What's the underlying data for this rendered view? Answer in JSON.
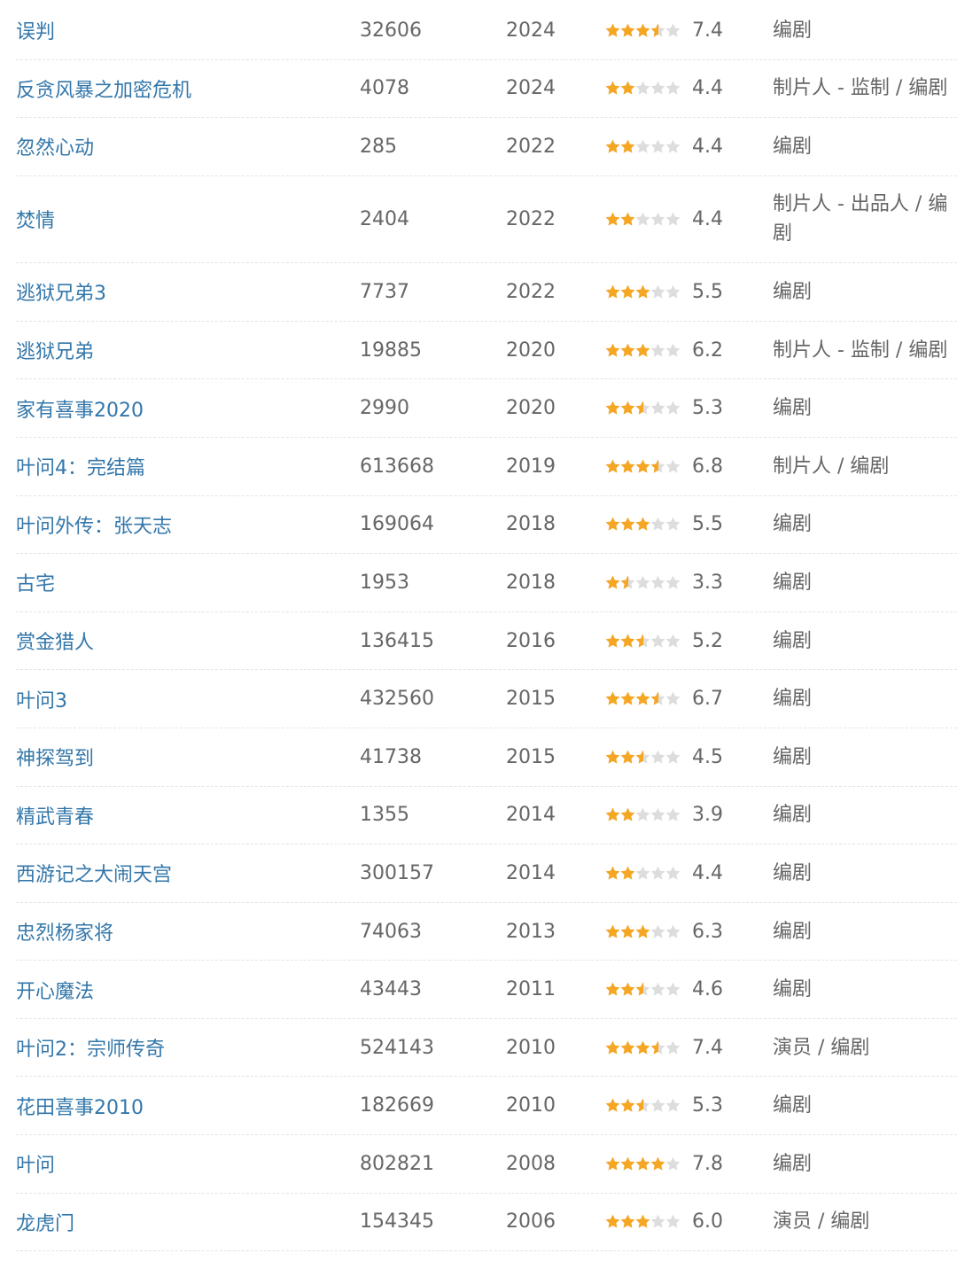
{
  "colors": {
    "link": "#3377aa",
    "text": "#666666",
    "star_filled": "#f5a623",
    "star_empty": "#dddddd"
  },
  "icon": "star-icon",
  "works": [
    {
      "title": "误判",
      "votes": "32606",
      "year": "2024",
      "stars": 3.5,
      "rating": "7.4",
      "role": "编剧"
    },
    {
      "title": "反贪风暴之加密危机",
      "votes": "4078",
      "year": "2024",
      "stars": 2,
      "rating": "4.4",
      "role": "制片人 - 监制 / 编剧"
    },
    {
      "title": "忽然心动",
      "votes": "285",
      "year": "2022",
      "stars": 2,
      "rating": "4.4",
      "role": "编剧"
    },
    {
      "title": "焚情",
      "votes": "2404",
      "year": "2022",
      "stars": 2,
      "rating": "4.4",
      "role": "制片人 - 出品人 / 编剧"
    },
    {
      "title": "逃狱兄弟3",
      "votes": "7737",
      "year": "2022",
      "stars": 3,
      "rating": "5.5",
      "role": "编剧"
    },
    {
      "title": "逃狱兄弟",
      "votes": "19885",
      "year": "2020",
      "stars": 3,
      "rating": "6.2",
      "role": "制片人 - 监制 / 编剧"
    },
    {
      "title": "家有喜事2020",
      "votes": "2990",
      "year": "2020",
      "stars": 2.5,
      "rating": "5.3",
      "role": "编剧"
    },
    {
      "title": "叶问4：完结篇",
      "votes": "613668",
      "year": "2019",
      "stars": 3.5,
      "rating": "6.8",
      "role": "制片人 / 编剧"
    },
    {
      "title": "叶问外传：张天志",
      "votes": "169064",
      "year": "2018",
      "stars": 3,
      "rating": "5.5",
      "role": "编剧"
    },
    {
      "title": "古宅",
      "votes": "1953",
      "year": "2018",
      "stars": 1.5,
      "rating": "3.3",
      "role": "编剧"
    },
    {
      "title": "赏金猎人",
      "votes": "136415",
      "year": "2016",
      "stars": 2.5,
      "rating": "5.2",
      "role": "编剧"
    },
    {
      "title": "叶问3",
      "votes": "432560",
      "year": "2015",
      "stars": 3.5,
      "rating": "6.7",
      "role": "编剧"
    },
    {
      "title": "神探驾到",
      "votes": "41738",
      "year": "2015",
      "stars": 2.5,
      "rating": "4.5",
      "role": "编剧"
    },
    {
      "title": "精武青春",
      "votes": "1355",
      "year": "2014",
      "stars": 2,
      "rating": "3.9",
      "role": "编剧"
    },
    {
      "title": "西游记之大闹天宫",
      "votes": "300157",
      "year": "2014",
      "stars": 2,
      "rating": "4.4",
      "role": "编剧"
    },
    {
      "title": "忠烈杨家将",
      "votes": "74063",
      "year": "2013",
      "stars": 3,
      "rating": "6.3",
      "role": "编剧"
    },
    {
      "title": "开心魔法",
      "votes": "43443",
      "year": "2011",
      "stars": 2.5,
      "rating": "4.6",
      "role": "编剧"
    },
    {
      "title": "叶问2：宗师传奇",
      "votes": "524143",
      "year": "2010",
      "stars": 3.5,
      "rating": "7.4",
      "role": "演员 / 编剧"
    },
    {
      "title": "花田喜事2010",
      "votes": "182669",
      "year": "2010",
      "stars": 2.5,
      "rating": "5.3",
      "role": "编剧"
    },
    {
      "title": "叶问",
      "votes": "802821",
      "year": "2008",
      "stars": 4,
      "rating": "7.8",
      "role": "编剧"
    },
    {
      "title": "龙虎门",
      "votes": "154345",
      "year": "2006",
      "stars": 3,
      "rating": "6.0",
      "role": "演员 / 编剧"
    }
  ]
}
